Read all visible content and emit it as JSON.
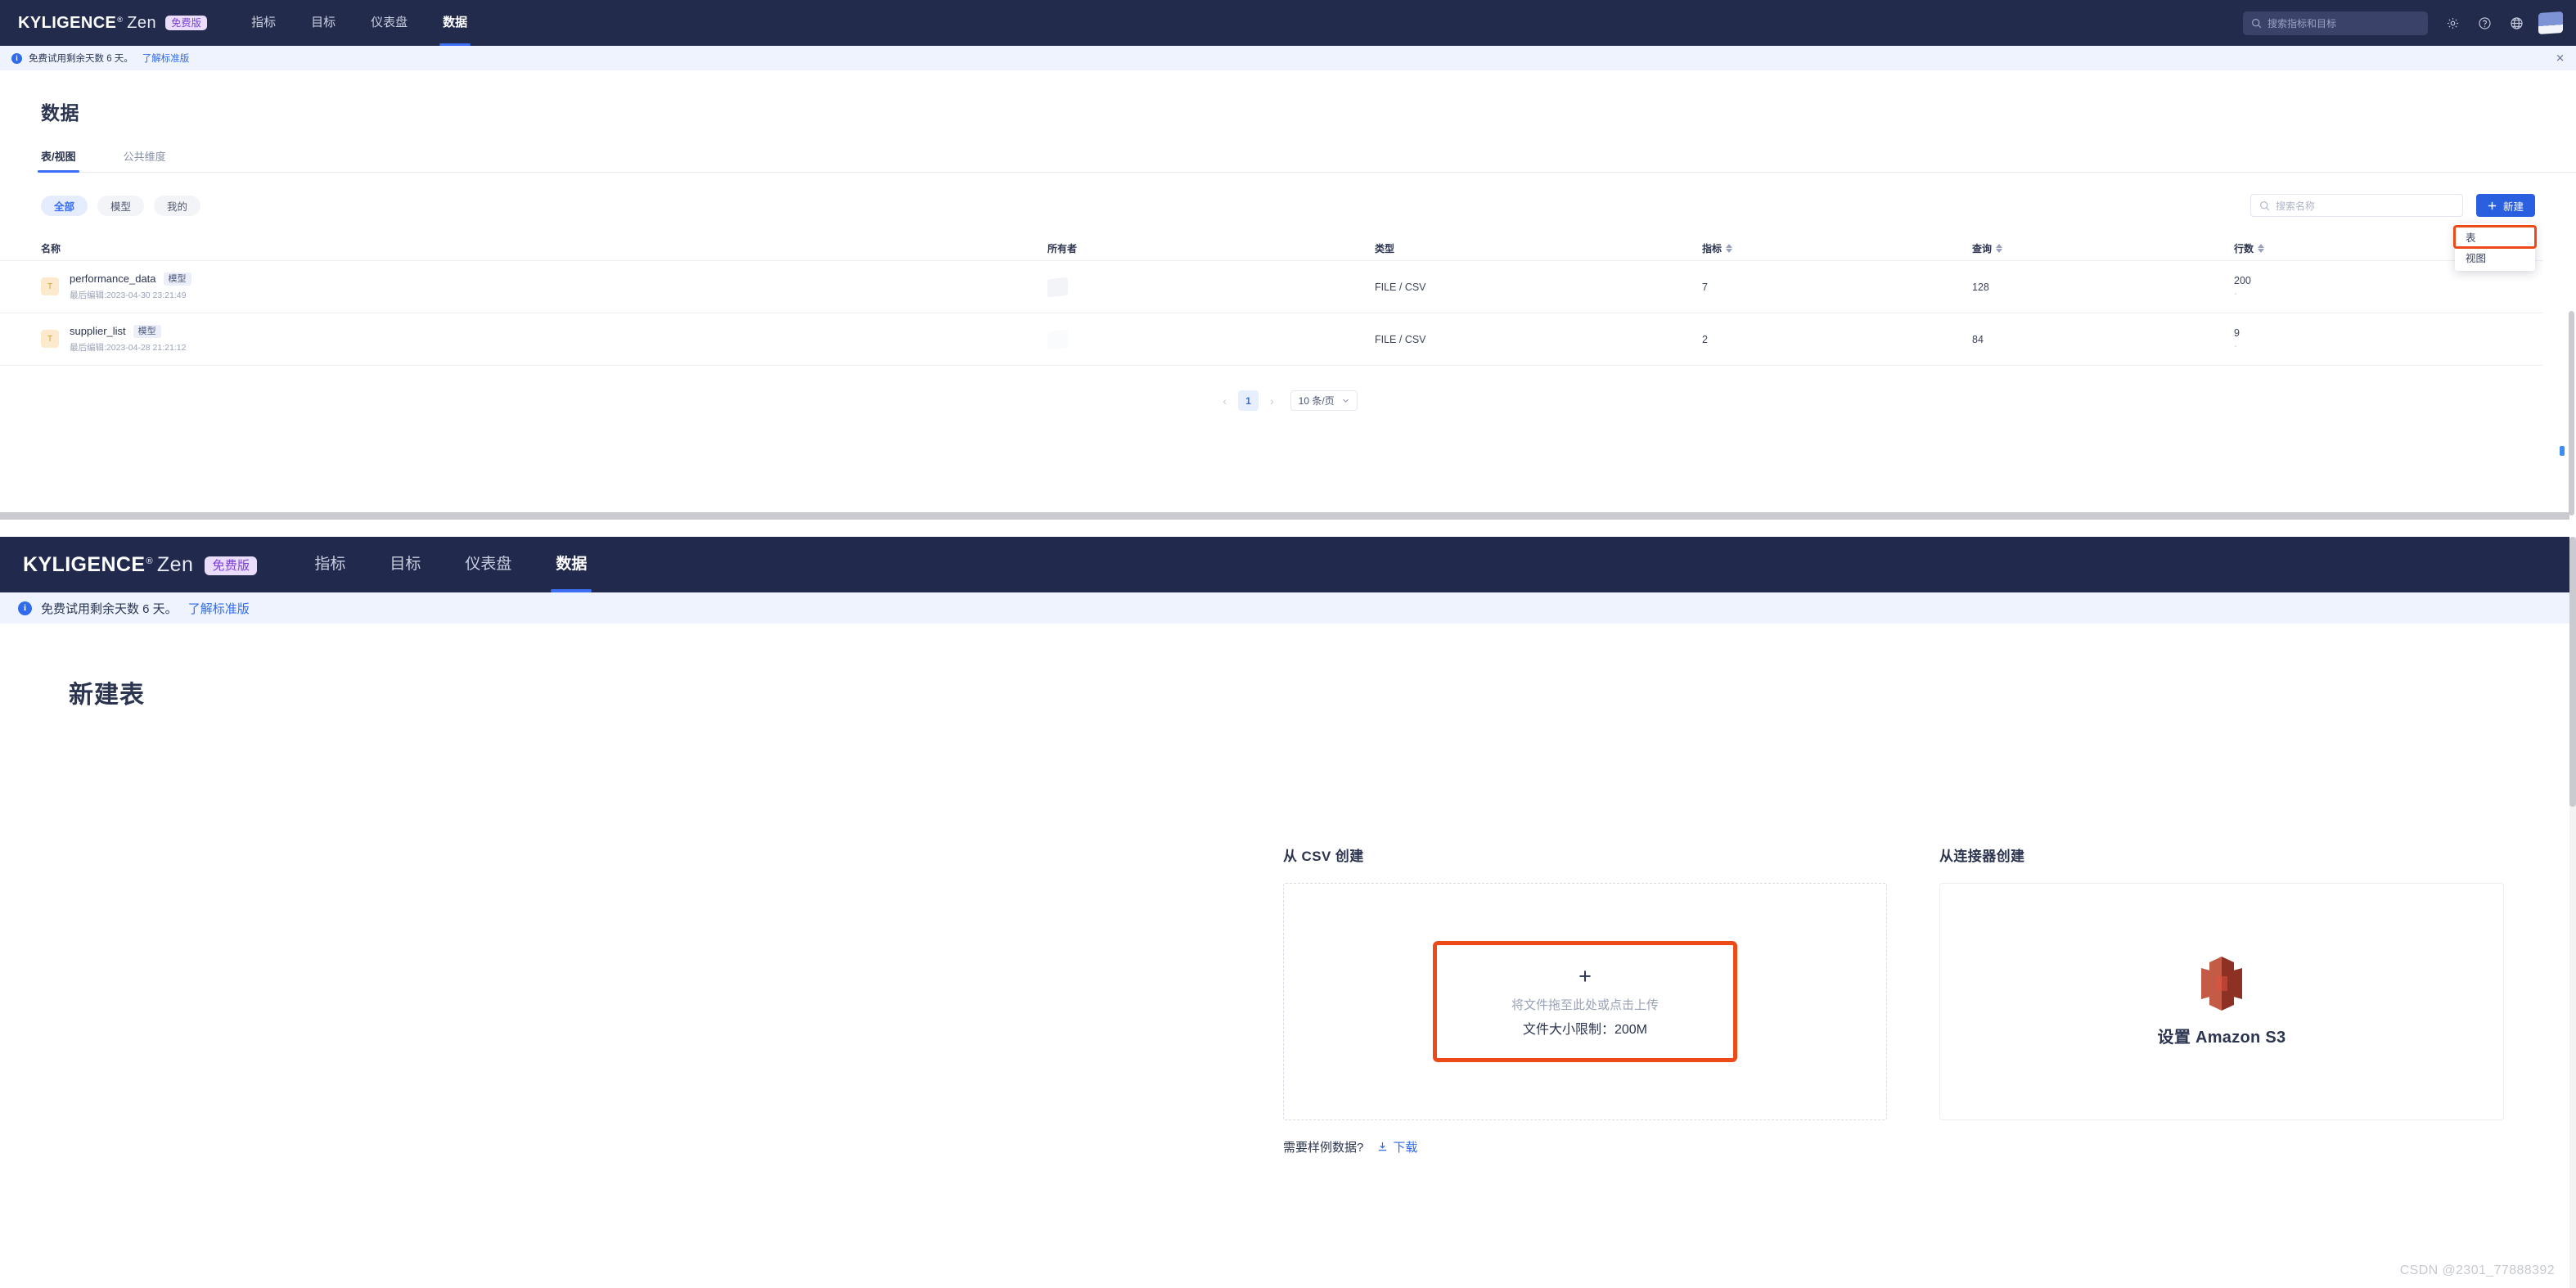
{
  "app": {
    "brand_main": "KYLIGENCE",
    "brand_sup": "®",
    "brand_sub": "Zen",
    "edition_badge": "免费版"
  },
  "navbar": {
    "links": [
      {
        "label": "指标",
        "active": false
      },
      {
        "label": "目标",
        "active": false
      },
      {
        "label": "仪表盘",
        "active": false
      },
      {
        "label": "数据",
        "active": true
      }
    ],
    "search_placeholder": "搜索指标和目标",
    "icons": [
      "gear-icon",
      "help-icon",
      "globe-icon",
      "avatar"
    ]
  },
  "notice": {
    "text": "免费试用剩余天数 6 天。",
    "link": "了解标准版",
    "close": "✕"
  },
  "top_view": {
    "page_title": "数据",
    "tabs": [
      {
        "label": "表/视图",
        "active": true
      },
      {
        "label": "公共维度",
        "active": false
      }
    ],
    "chips": [
      {
        "label": "全部",
        "active": true
      },
      {
        "label": "模型",
        "active": false
      },
      {
        "label": "我的",
        "active": false
      }
    ],
    "search_placeholder": "搜索名称",
    "new_button": "新建",
    "new_button_icon": "plus-icon",
    "dropdown": [
      {
        "label": "表",
        "highlighted": true
      },
      {
        "label": "视图",
        "highlighted": false
      }
    ],
    "table": {
      "columns": [
        {
          "key": "name",
          "label": "名称",
          "sortable": false
        },
        {
          "key": "owner",
          "label": "所有者",
          "sortable": false
        },
        {
          "key": "type",
          "label": "类型",
          "sortable": false
        },
        {
          "key": "index",
          "label": "指标",
          "sortable": true
        },
        {
          "key": "query",
          "label": "查询",
          "sortable": true
        },
        {
          "key": "rows",
          "label": "行数",
          "sortable": true
        }
      ],
      "rows": [
        {
          "icon": "T",
          "name": "performance_data",
          "tag": "模型",
          "meta": "最后编辑:2023-04-30 23:21:49",
          "owner": "",
          "type": "FILE / CSV",
          "index": "7",
          "query": "128",
          "rows": "200",
          "rows_sub": "-"
        },
        {
          "icon": "T",
          "name": "supplier_list",
          "tag": "模型",
          "meta": "最后编辑:2023-04-28 21:21:12",
          "owner": "",
          "type": "FILE / CSV",
          "index": "2",
          "query": "84",
          "rows": "9",
          "rows_sub": "-"
        }
      ]
    },
    "pagination": {
      "prev": "‹",
      "page": "1",
      "next": "›",
      "page_size": "10 条/页"
    }
  },
  "bottom_view": {
    "page_title": "新建表",
    "csv": {
      "heading": "从 CSV 创建",
      "plus": "+",
      "drop_hint": "将文件拖至此处或点击上传",
      "size_limit": "文件大小限制：200M",
      "sample_question": "需要样例数据?",
      "download_label": "下载"
    },
    "connector": {
      "heading": "从连接器创建",
      "label": "设置 Amazon S3",
      "logo": "amazon-s3-logo"
    }
  },
  "watermark": "CSDN @2301_77888392",
  "colors": {
    "nav_bg": "#232b4d",
    "accent_blue": "#2a5fe0",
    "highlight_orange": "#ec4a18",
    "badge_purple": "#7a3fd6",
    "notice_bg": "#eef3fe"
  }
}
